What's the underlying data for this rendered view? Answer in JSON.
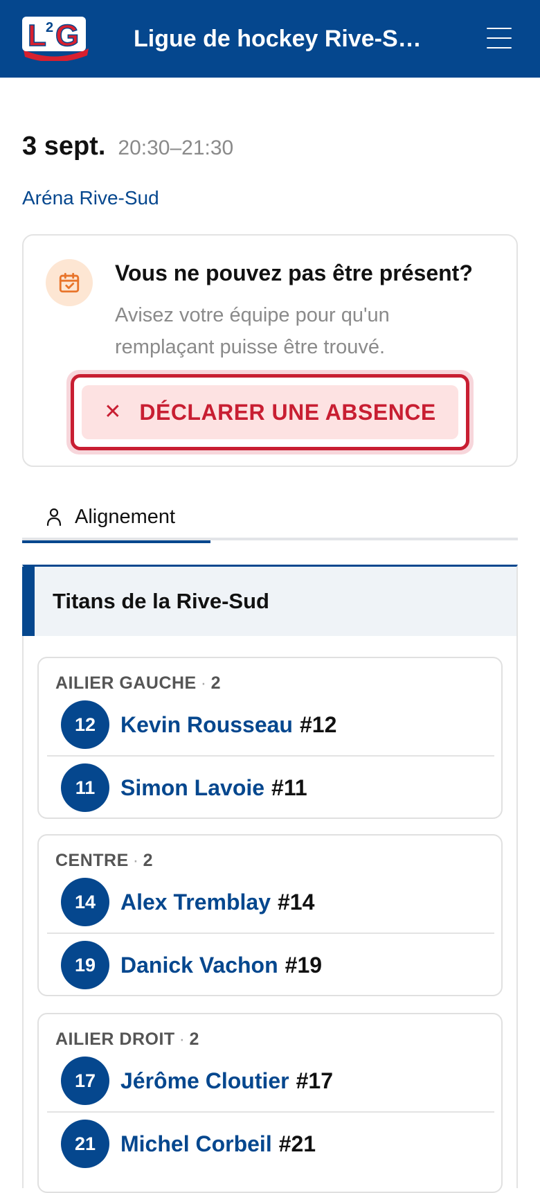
{
  "header": {
    "logo_text": "L2G",
    "title": "Ligue de hockey Rive-S…",
    "menu_icon": "hamburger-menu-icon"
  },
  "game": {
    "date": "3 sept.",
    "time": "20:30–21:30",
    "venue": "Aréna Rive-Sud"
  },
  "absence": {
    "icon": "calendar-check-icon",
    "title": "Vous ne pouvez pas être présent?",
    "description": "Avisez votre équipe pour qu'un remplaçant puisse être trouvé.",
    "button_label": "DÉCLARER UNE ABSENCE",
    "button_icon": "close-icon"
  },
  "tabs": [
    {
      "label": "Alignement",
      "icon": "person-icon",
      "active": true
    }
  ],
  "team": {
    "name": "Titans de la Rive-Sud",
    "groups": [
      {
        "position": "AILIER GAUCHE",
        "count": "2",
        "players": [
          {
            "number": "12",
            "name": "Kevin Rousseau",
            "jersey": "#12"
          },
          {
            "number": "11",
            "name": "Simon Lavoie",
            "jersey": "#11"
          }
        ]
      },
      {
        "position": "CENTRE",
        "count": "2",
        "players": [
          {
            "number": "14",
            "name": "Alex Tremblay",
            "jersey": "#14"
          },
          {
            "number": "19",
            "name": "Danick Vachon",
            "jersey": "#19"
          }
        ]
      },
      {
        "position": "AILIER DROIT",
        "count": "2",
        "players": [
          {
            "number": "17",
            "name": "Jérôme Cloutier",
            "jersey": "#17"
          },
          {
            "number": "21",
            "name": "Michel Corbeil",
            "jersey": "#21"
          }
        ]
      }
    ]
  },
  "colors": {
    "primary": "#05478e",
    "danger": "#c81e32",
    "danger_bg": "#fde2e2",
    "icon_bg": "#fde6d3",
    "icon_fg": "#e8742a"
  }
}
